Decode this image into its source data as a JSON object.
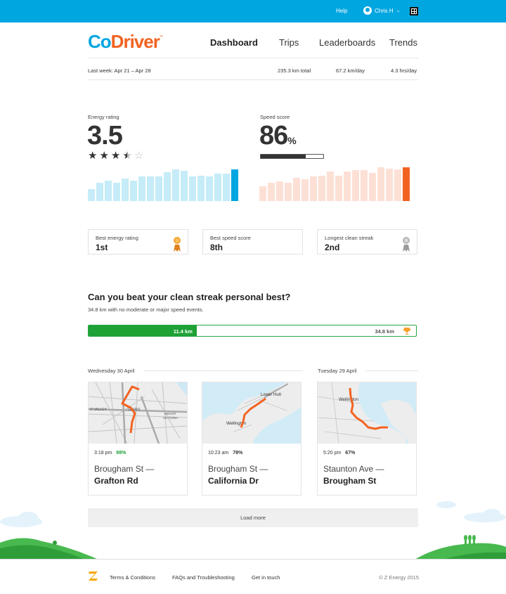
{
  "topbar": {
    "help": "Help",
    "user_name": "Chris H",
    "user_chevron": "⌄",
    "icons": [
      "avatar-icon",
      "chevron-down-icon",
      "app-grid-icon"
    ]
  },
  "brand": {
    "co": "Co",
    "driver": "Driver",
    "tm": "™"
  },
  "nav": [
    "Dashboard",
    "Trips",
    "Leaderboards",
    "Trends"
  ],
  "summary": {
    "period": "Last week: Apr 21 – Apr 28",
    "total": "235.3 km total",
    "per_day": "67.2 km/day",
    "hours": "4.3 hrs/day"
  },
  "energy": {
    "label": "Energy rating",
    "value": "3.5",
    "stars": 3.5,
    "max_stars": 5,
    "bars": [
      0.36,
      0.54,
      0.6,
      0.54,
      0.66,
      0.6,
      0.72,
      0.72,
      0.72,
      0.86,
      0.94,
      0.9,
      0.72,
      0.76,
      0.72,
      0.82,
      0.82,
      0.94
    ],
    "color": "#c5ecf8",
    "highlight_color": "#00a6e0"
  },
  "speed": {
    "label": "Speed score",
    "value": "86",
    "unit": "%",
    "progress": 0.72,
    "bars": [
      0.44,
      0.54,
      0.58,
      0.54,
      0.68,
      0.64,
      0.72,
      0.76,
      0.88,
      0.76,
      0.88,
      0.92,
      0.92,
      0.84,
      1.0,
      0.96,
      0.94,
      1.0
    ],
    "color": "#fde0d5",
    "highlight_color": "#f26322"
  },
  "achievements": [
    {
      "title": "Best energy rating",
      "value": "1st",
      "icon": "gold-medal-icon",
      "color": "#f7a231"
    },
    {
      "title": "Best speed score",
      "value": "8th",
      "icon": "",
      "color": ""
    },
    {
      "title": "Longest clean streak",
      "value": "2nd",
      "icon": "silver-medal-icon",
      "color": "#b3b3b3"
    }
  ],
  "streak": {
    "title": "Can you beat your clean streak personal best?",
    "subtitle": "34.8 km with no moderate or major speed events.",
    "current": "11.4 km",
    "goal": "34.8 km",
    "progress": 0.33,
    "icon": "trophy-icon"
  },
  "days": [
    "Wednesday 30 April",
    "Tuesday 29 April"
  ],
  "trips": [
    {
      "time": "3:18 pm",
      "score": "98%",
      "score_color": "#1ea135",
      "from": "Brougham St —",
      "to": "Grafton Rd",
      "map_labels": [
        "O VALLEY",
        "TE ARO",
        "MOUNT",
        "VICTORIA"
      ]
    },
    {
      "time": "10:23 am",
      "score": "78%",
      "score_color": "#333333",
      "from": "Brougham St —",
      "to": "California Dr",
      "map_labels": [
        "Lower Hutt",
        "Wellington"
      ]
    },
    {
      "time": "5:20 pm",
      "score": "67%",
      "score_color": "#333333",
      "from": "Staunton Ave —",
      "to": "Brougham St",
      "map_labels": [
        "Wellington"
      ]
    }
  ],
  "load_more": "Load more",
  "footer": {
    "links": [
      "Terms & Conditions",
      "FAQs and Troubleshooting",
      "Get in touch"
    ],
    "copyright": "© Z Energy 2015",
    "logo_icon": "z-energy-logo-icon"
  },
  "colors": {
    "brand_blue": "#00a6e0",
    "brand_orange": "#f26322",
    "streak_green": "#1ea135",
    "hill_green": "#48b94f"
  }
}
